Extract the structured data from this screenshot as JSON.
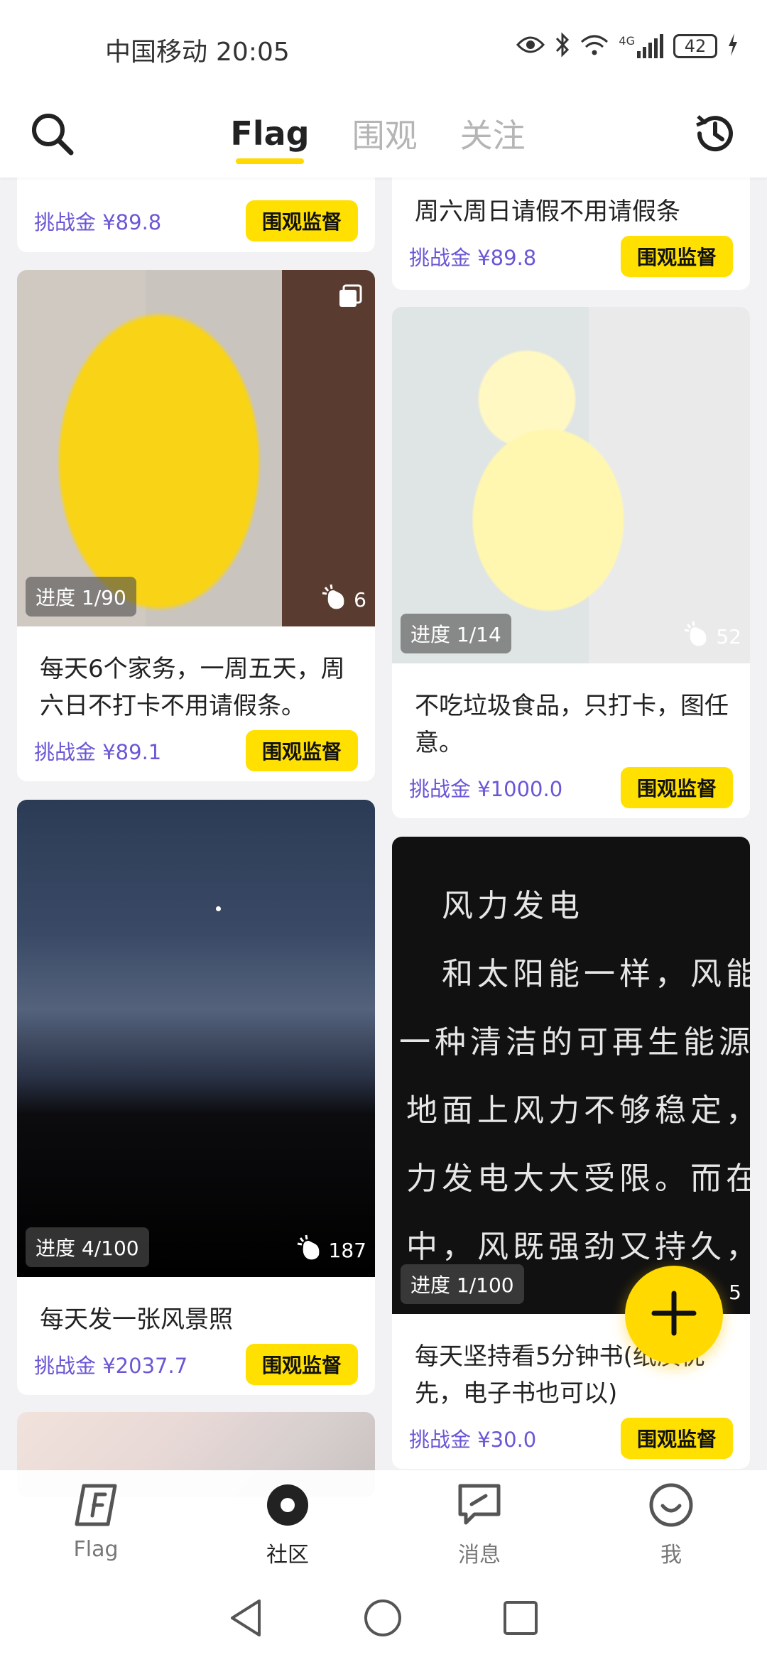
{
  "status_bar": {
    "carrier": "中国移动",
    "time": "20:05",
    "network": "4G",
    "battery": "42"
  },
  "header": {
    "tabs": [
      {
        "label": "Flag",
        "active": true
      },
      {
        "label": "围观",
        "active": false
      },
      {
        "label": "关注",
        "active": false
      }
    ],
    "accent_color": "#ffd900"
  },
  "feed": {
    "left": [
      {
        "title": "",
        "prize": "挑战金 ¥89.8",
        "button": "围观监督",
        "partial": true
      },
      {
        "progress": "进度 1/90",
        "likes": "6",
        "title": "每天6个家务，一周五天，周六日不打卡不用请假条。",
        "prize": "挑战金 ¥89.1",
        "button": "围观监督"
      },
      {
        "progress": "进度 4/100",
        "likes": "187",
        "title": "每天发一张风景照",
        "prize": "挑战金 ¥2037.7",
        "button": "围观监督"
      }
    ],
    "right": [
      {
        "title": "周六周日请假不用请假条",
        "prize": "挑战金 ¥89.8",
        "button": "围观监督",
        "partial": true
      },
      {
        "progress": "进度 1/14",
        "likes": "52",
        "title": "不吃垃圾食品，只打卡，图任意。",
        "prize": "挑战金 ¥1000.0",
        "button": "围观监督"
      },
      {
        "progress": "进度 1/100",
        "likes": "5",
        "title": "每天坚持看5分钟书(纸质优先，电子书也可以)",
        "prize": "挑战金 ¥30.0",
        "button": "围观监督",
        "image_text": [
          "风力发电",
          "和太阳能一样，风能",
          "一种清洁的可再生能源",
          "地面上风力不够稳定，",
          "力发电大大受限。而在",
          "中，风既强劲又持久，"
        ]
      }
    ]
  },
  "bottom_nav": [
    {
      "label": "Flag",
      "icon": "flag-icon",
      "active": false
    },
    {
      "label": "社区",
      "icon": "community-icon",
      "active": true
    },
    {
      "label": "消息",
      "icon": "message-icon",
      "active": false
    },
    {
      "label": "我",
      "icon": "profile-icon",
      "active": false
    }
  ],
  "colors": {
    "prize_text": "#6a57d6",
    "button_bg": "#ffe000",
    "fab_bg": "#ffd900"
  }
}
